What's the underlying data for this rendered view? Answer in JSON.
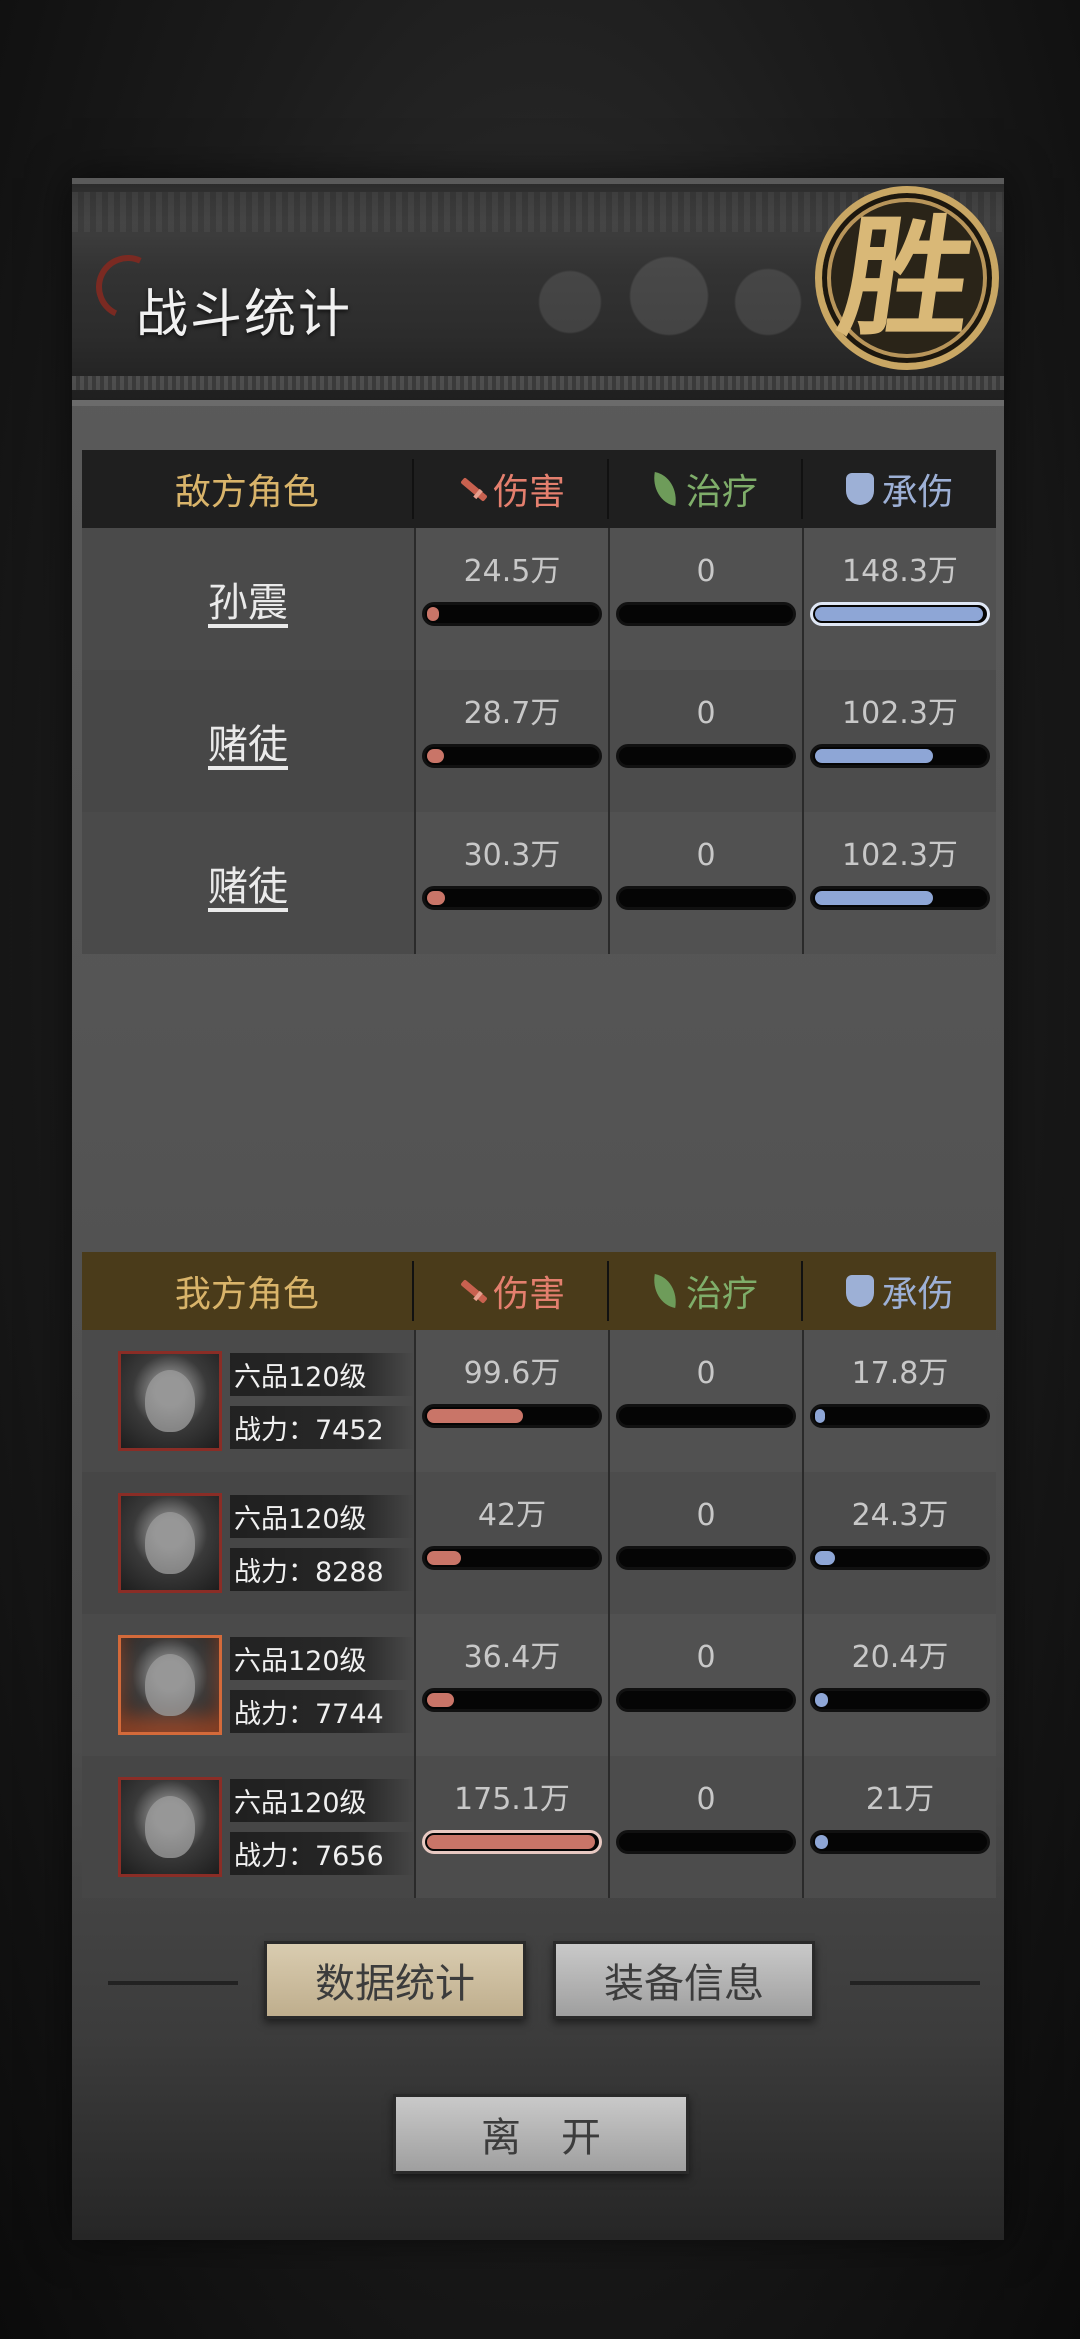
{
  "header": {
    "title": "战斗统计",
    "result_seal": "胜"
  },
  "columns": {
    "damage": "伤害",
    "heal": "治疗",
    "taken": "承伤"
  },
  "enemy": {
    "label": "敌方角色",
    "rows": [
      {
        "name": "孙震",
        "damage": "24.5万",
        "heal": "0",
        "taken": "148.3万",
        "damage_frac": 0.07,
        "heal_frac": 0,
        "taken_frac": 1.0
      },
      {
        "name": "赌徒",
        "damage": "28.7万",
        "heal": "0",
        "taken": "102.3万",
        "damage_frac": 0.1,
        "heal_frac": 0,
        "taken_frac": 0.7
      },
      {
        "name": "赌徒",
        "damage": "30.3万",
        "heal": "0",
        "taken": "102.3万",
        "damage_frac": 0.11,
        "heal_frac": 0,
        "taken_frac": 0.7
      }
    ]
  },
  "ally": {
    "label": "我方角色",
    "rows": [
      {
        "rank": "六品120级",
        "power": "战力：7452",
        "damage": "99.6万",
        "heal": "0",
        "taken": "17.8万",
        "damage_frac": 0.57,
        "heal_frac": 0,
        "taken_frac": 0.05
      },
      {
        "rank": "六品120级",
        "power": "战力：8288",
        "damage": "42万",
        "heal": "0",
        "taken": "24.3万",
        "damage_frac": 0.2,
        "heal_frac": 0,
        "taken_frac": 0.12
      },
      {
        "rank": "六品120级",
        "power": "战力：7744",
        "damage": "36.4万",
        "heal": "0",
        "taken": "20.4万",
        "damage_frac": 0.16,
        "heal_frac": 0,
        "taken_frac": 0.08
      },
      {
        "rank": "六品120级",
        "power": "战力：7656",
        "damage": "175.1万",
        "heal": "0",
        "taken": "21万",
        "damage_frac": 1.0,
        "heal_frac": 0,
        "taken_frac": 0.08
      }
    ]
  },
  "buttons": {
    "stats": "数据统计",
    "equipment": "装备信息",
    "leave": "离开"
  },
  "colors": {
    "damage": "#c97568",
    "heal": "#6e9c5a",
    "taken": "#8ea6d6",
    "gold": "#d9b46a"
  }
}
